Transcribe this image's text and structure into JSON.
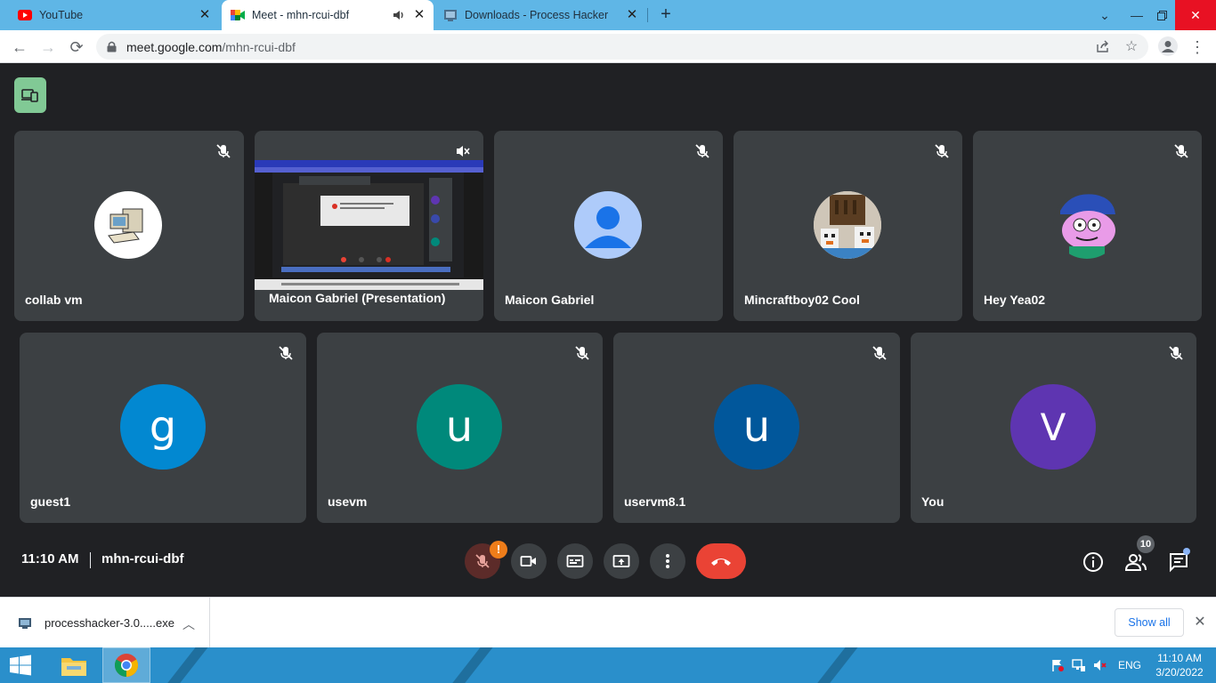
{
  "browser": {
    "tabs": [
      {
        "title": "YouTube",
        "icon": "youtube-icon",
        "active": false
      },
      {
        "title": "Meet - mhn-rcui-dbf",
        "icon": "meet-icon",
        "active": true,
        "audio": true
      },
      {
        "title": "Downloads - Process Hacker",
        "icon": "process-hacker-icon",
        "active": false
      }
    ],
    "new_tab": "+",
    "url_host": "meet.google.com",
    "url_path": "/mhn-rcui-dbf"
  },
  "meet": {
    "participants_row1": [
      {
        "name": "collab vm",
        "avatar": "computer-avatar"
      },
      {
        "name": "Maicon Gabriel (Presentation)",
        "avatar": "screen-share"
      },
      {
        "name": "Maicon Gabriel",
        "avatar": "default-person-avatar"
      },
      {
        "name": "Mincraftboy02 Cool",
        "avatar": "minecraft-avatar"
      },
      {
        "name": "Hey Yea02",
        "avatar": "cartoon-avatar"
      }
    ],
    "participants_row2": [
      {
        "name": "guest1",
        "initial": "g",
        "color": "#0288d1"
      },
      {
        "name": "usevm",
        "initial": "u",
        "color": "#00897b"
      },
      {
        "name": "uservm8.1",
        "initial": "u",
        "color": "#01579b"
      },
      {
        "name": "You",
        "initial": "V",
        "color": "#5e35b1"
      }
    ],
    "time": "11:10 AM",
    "meeting_code": "mhn-rcui-dbf",
    "warning_badge": "!",
    "people_count": "10"
  },
  "downloads": {
    "file_name": "processhacker-3.0.....exe",
    "show_all": "Show all"
  },
  "taskbar": {
    "language": "ENG",
    "time": "11:10 AM",
    "date": "3/20/2022"
  },
  "colors": {
    "meet_bg": "#202124",
    "tile_bg": "#3c4043",
    "leave_red": "#ea4335",
    "taskbar_blue": "#2a8fcb",
    "tabstrip_blue": "#5fb6e6"
  }
}
